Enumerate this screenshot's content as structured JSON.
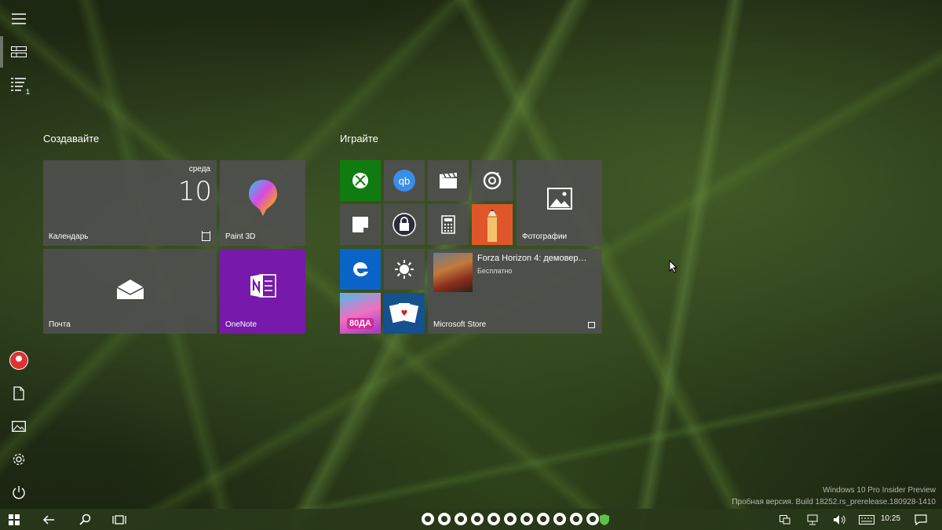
{
  "rail": {
    "icons": [
      "hamburger-menu-icon",
      "tiles-view-icon",
      "all-apps-list-icon",
      "user-avatar",
      "documents-icon",
      "pictures-icon",
      "settings-icon",
      "power-icon"
    ],
    "list_badge": "1"
  },
  "groups": [
    {
      "title": "Создавайте"
    },
    {
      "title": "Играйте"
    }
  ],
  "tiles": {
    "calendar": {
      "label": "Календарь",
      "weekday": "среда",
      "day": "10"
    },
    "paint3d": {
      "label": "Paint 3D"
    },
    "mail": {
      "label": "Почта"
    },
    "onenote": {
      "label": "OneNote"
    },
    "photos": {
      "label": "Фотографии"
    },
    "store": {
      "label": "Microsoft Store",
      "title": "Forza Horizon 4: демовер…",
      "subtitle": "Бесплатно"
    },
    "candy_text": "80ДА"
  },
  "colors": {
    "tile_gray": "#505050",
    "xbox_green": "#107c10",
    "onenote_purple": "#7719aa",
    "edge_blue": "#0a64c8",
    "taskbar": "#28381a"
  },
  "watermark": {
    "line1": "Windows 10 Pro Insider Preview",
    "line2": "Пробная версия. Build 18252.rs_prerelease.180928-1410"
  },
  "taskbar": {
    "time": "10:25",
    "pinned_count": 11
  }
}
